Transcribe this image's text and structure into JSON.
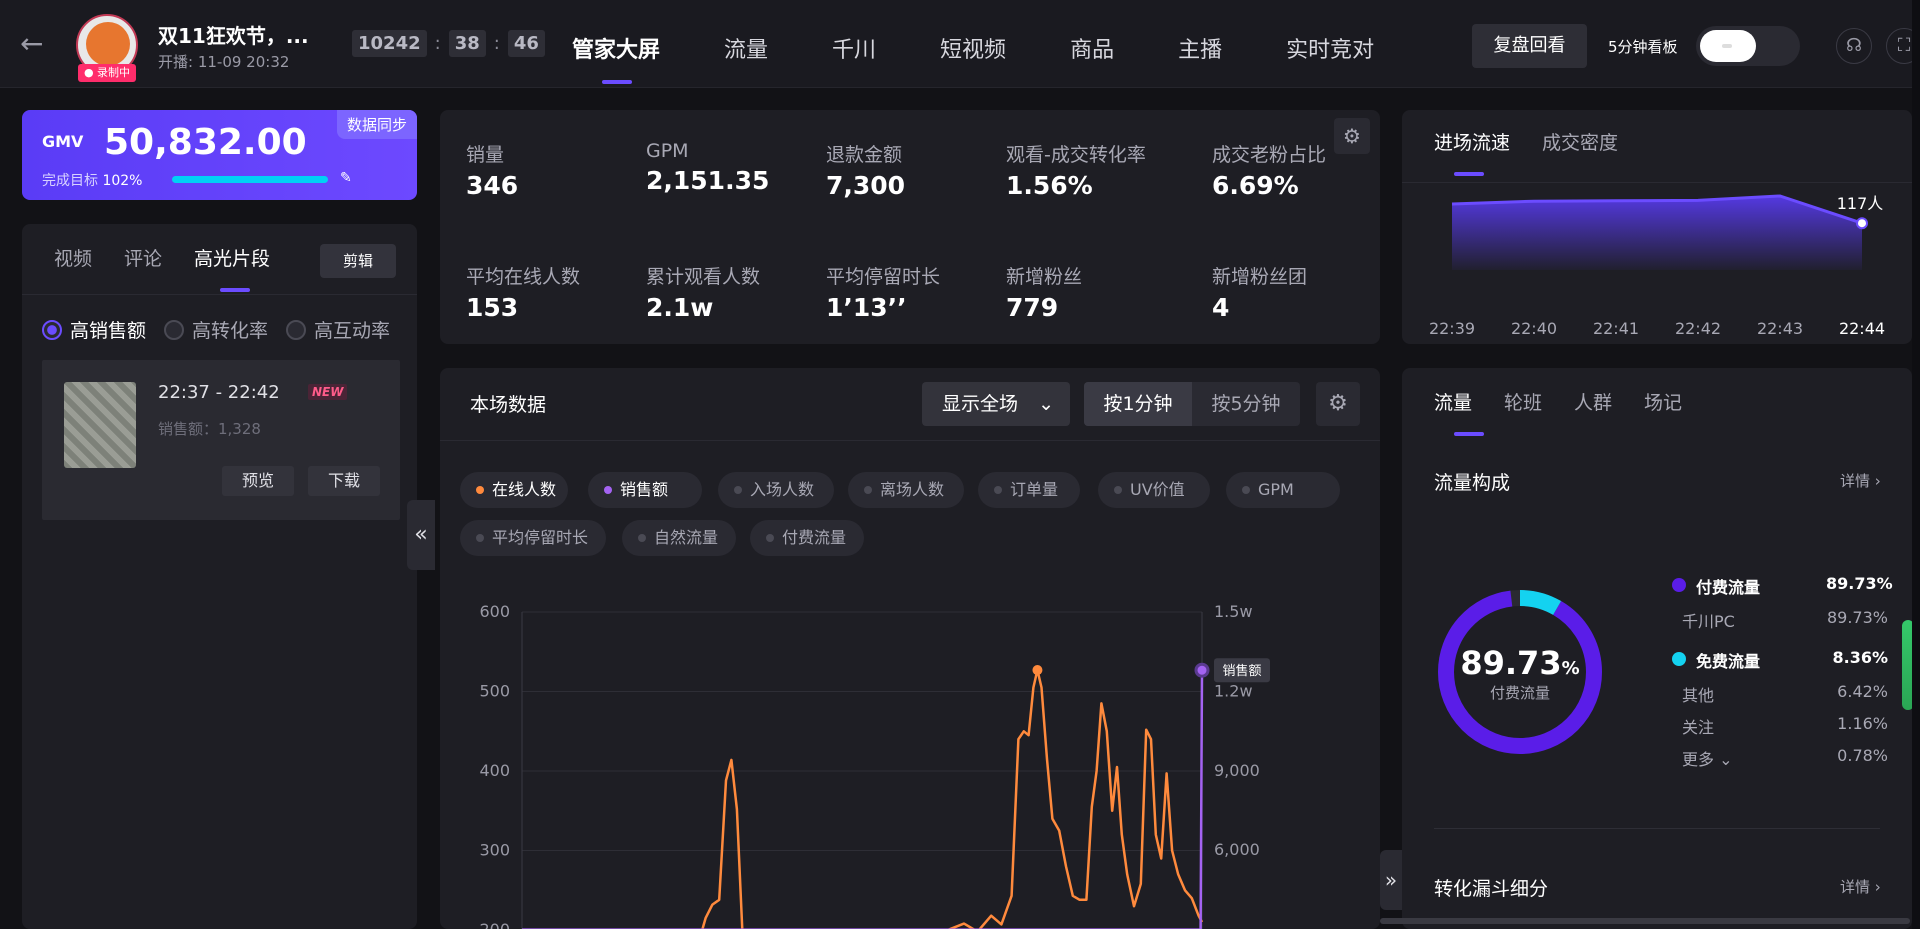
{
  "header": {
    "title": "双11狂欢节，...",
    "start_time": "开播:  11-09 20:32",
    "recording_badge": "● 录制中",
    "timer": [
      "10242",
      "38",
      "46"
    ],
    "timer_sep": ":",
    "nav": [
      {
        "label": "管家大屏",
        "active": true
      },
      {
        "label": "流量",
        "active": false
      },
      {
        "label": "千川",
        "active": false
      },
      {
        "label": "短视频",
        "active": false
      },
      {
        "label": "商品",
        "active": false
      },
      {
        "label": "主播",
        "active": false
      },
      {
        "label": "实时竞对",
        "active": false
      }
    ],
    "replay_button": "复盘回看",
    "board_label": "5分钟看板"
  },
  "gmv": {
    "label": "GMV",
    "value": "50,832.00",
    "sync": "数据同步",
    "target_label": "完成目标",
    "target_pct": "102%",
    "progress": 1.0
  },
  "left_panel": {
    "tabs": [
      "视频",
      "评论",
      "高光片段"
    ],
    "active_tab": 2,
    "edit_button": "剪辑",
    "radios": [
      {
        "label": "高销售额",
        "checked": true
      },
      {
        "label": "高转化率",
        "checked": false
      },
      {
        "label": "高互动率",
        "checked": false
      }
    ],
    "clip": {
      "time": "22:37 - 22:42",
      "badge": "NEW",
      "sales": "销售额：1,328",
      "preview": "预览",
      "download": "下载"
    }
  },
  "metrics": [
    {
      "label": "销量",
      "value": "346"
    },
    {
      "label": "GPM",
      "value": "2,151.35"
    },
    {
      "label": "退款金额",
      "value": "7,300"
    },
    {
      "label": "观看-成交转化率",
      "value": "1.56%"
    },
    {
      "label": "成交老粉占比",
      "value": "6.69%"
    },
    {
      "label": "平均在线人数",
      "value": "153"
    },
    {
      "label": "累计观看人数",
      "value": "2.1w"
    },
    {
      "label": "平均停留时长",
      "value": "1’13’’"
    },
    {
      "label": "新增粉丝",
      "value": "779"
    },
    {
      "label": "新增粉丝团",
      "value": "4"
    }
  ],
  "chart_panel": {
    "title": "本场数据",
    "select": "显示全场",
    "seg": [
      "按1分钟",
      "按5分钟"
    ],
    "chips": [
      {
        "label": "在线人数",
        "on": true,
        "color": "orange"
      },
      {
        "label": "销售额",
        "on": true,
        "color": "purple"
      },
      {
        "label": "入场人数",
        "on": false
      },
      {
        "label": "离场人数",
        "on": false
      },
      {
        "label": "订单量",
        "on": false
      },
      {
        "label": "UV价值",
        "on": false
      },
      {
        "label": "GPM",
        "on": false
      },
      {
        "label": "平均停留时长",
        "on": false
      },
      {
        "label": "自然流量",
        "on": false
      },
      {
        "label": "付费流量",
        "on": false
      }
    ],
    "sales_tag": "销售额"
  },
  "chart_data": {
    "type": "line",
    "y_left_ticks": [
      "600",
      "500",
      "400",
      "300",
      "200"
    ],
    "y_right_ticks": [
      "1.5w",
      "1.2w",
      "9,000",
      "6,000"
    ],
    "ylim_left": [
      200,
      600
    ],
    "ylim_right": [
      3000,
      15000
    ],
    "series": [
      {
        "name": "在线人数",
        "axis": "left",
        "color": "#ff8a3d",
        "values": [
          [
            0.265,
            200
          ],
          [
            0.27,
            215
          ],
          [
            0.28,
            232
          ],
          [
            0.29,
            238
          ],
          [
            0.3,
            388
          ],
          [
            0.308,
            414
          ],
          [
            0.316,
            352
          ],
          [
            0.324,
            200
          ],
          [
            0.47,
            200
          ],
          [
            0.6,
            200
          ],
          [
            0.62,
            198
          ],
          [
            0.65,
            208
          ],
          [
            0.67,
            198
          ],
          [
            0.69,
            218
          ],
          [
            0.705,
            207
          ],
          [
            0.72,
            243
          ],
          [
            0.73,
            440
          ],
          [
            0.738,
            450
          ],
          [
            0.745,
            445
          ],
          [
            0.752,
            505
          ],
          [
            0.758,
            527
          ],
          [
            0.764,
            505
          ],
          [
            0.772,
            415
          ],
          [
            0.78,
            340
          ],
          [
            0.79,
            325
          ],
          [
            0.8,
            280
          ],
          [
            0.81,
            243
          ],
          [
            0.82,
            238
          ],
          [
            0.83,
            238
          ],
          [
            0.838,
            355
          ],
          [
            0.845,
            400
          ],
          [
            0.852,
            485
          ],
          [
            0.86,
            450
          ],
          [
            0.868,
            350
          ],
          [
            0.875,
            405
          ],
          [
            0.882,
            320
          ],
          [
            0.89,
            270
          ],
          [
            0.9,
            230
          ],
          [
            0.91,
            258
          ],
          [
            0.918,
            452
          ],
          [
            0.925,
            440
          ],
          [
            0.932,
            320
          ],
          [
            0.94,
            290
          ],
          [
            0.948,
            397
          ],
          [
            0.956,
            300
          ],
          [
            0.965,
            270
          ],
          [
            0.975,
            250
          ],
          [
            0.985,
            240
          ],
          [
            0.995,
            218
          ],
          [
            1.0,
            210
          ]
        ]
      },
      {
        "name": "销售额",
        "axis": "right",
        "color": "#a463f2",
        "values": [
          [
            0.0,
            3000
          ],
          [
            0.998,
            3000
          ],
          [
            1.0,
            12800
          ]
        ]
      }
    ]
  },
  "speed": {
    "tabs": [
      "进场流速",
      "成交密度"
    ],
    "active_tab": 0,
    "last_value": "117人",
    "x_labels": [
      "22:39",
      "22:40",
      "22:41",
      "22:42",
      "22:43",
      "22:44"
    ],
    "values": [
      165,
      172,
      173,
      174,
      185,
      117
    ]
  },
  "traffic": {
    "tabs": [
      "流量",
      "轮班",
      "人群",
      "场记"
    ],
    "active_tab": 0,
    "title": "流量构成",
    "detail": "详情 ›",
    "donut_value": "89.73",
    "donut_unit": "%",
    "donut_label": "付费流量",
    "paid": {
      "label": "付费流量",
      "value": "89.73%",
      "color": "#5a1de8"
    },
    "paid_sub": [
      {
        "label": "千川PC",
        "value": "89.73%"
      }
    ],
    "free": {
      "label": "免费流量",
      "value": "8.36%",
      "color": "#14d2f0"
    },
    "free_sub": [
      {
        "label": "其他",
        "value": "6.42%"
      },
      {
        "label": "关注",
        "value": "1.16%"
      },
      {
        "label": "更多 ⌄",
        "value": "0.78%"
      }
    ],
    "funnel_title": "转化漏斗细分",
    "funnel_detail": "详情 ›",
    "donut_paid_frac": 0.8973,
    "donut_free_frac": 0.0836
  }
}
